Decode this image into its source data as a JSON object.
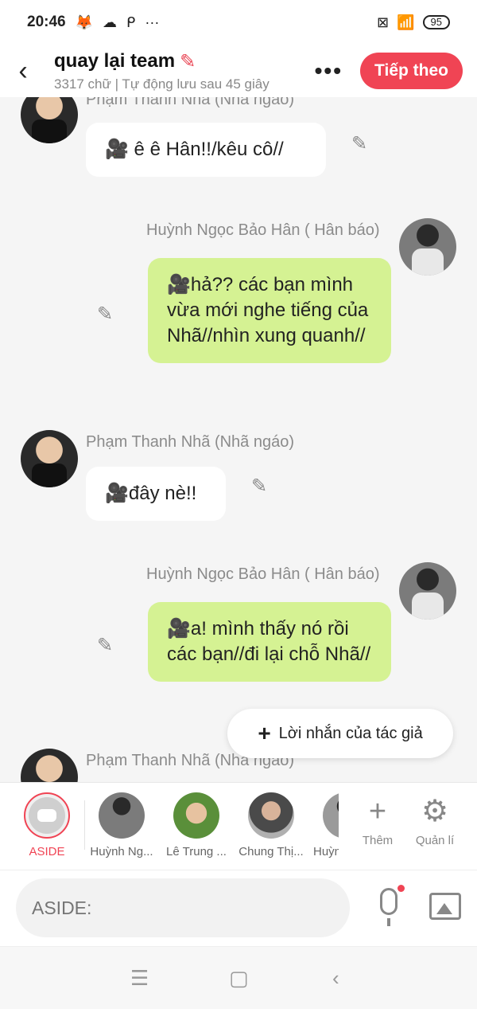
{
  "status_bar": {
    "time": "20:46",
    "left_icons": [
      "fox-icon",
      "cloud-icon",
      "p-icon",
      "ellipsis-icon"
    ],
    "ellipsis": "···",
    "battery": "95"
  },
  "header": {
    "title": "quay lại team",
    "subtitle": "3317 chữ | Tự động lưu sau 45 giây",
    "more": "•••",
    "next_label": "Tiếp theo"
  },
  "messages": [
    {
      "side": "left",
      "sender": "Phạm Thanh Nhã (Nhã ngáo)",
      "text": "🎥 ê ê Hân!!/kêu cô//"
    },
    {
      "side": "right",
      "sender": "Huỳnh Ngọc Bảo Hân ( Hân báo)",
      "text": "🎥hả?? các bạn mình vừa mới nghe tiếng của Nhã//nhìn xung quanh//"
    },
    {
      "side": "left",
      "sender": "Phạm Thanh Nhã (Nhã ngáo)",
      "text": "🎥đây nè!!"
    },
    {
      "side": "right",
      "sender": "Huỳnh Ngọc Bảo Hân ( Hân báo)",
      "text": "🎥a! mình thấy nó rồi các bạn//đi lại chỗ Nhã//"
    },
    {
      "side": "left",
      "sender": "Phạm Thanh Nhã (Nhã ngáo)",
      "text": ""
    }
  ],
  "author_note": {
    "label": "Lời nhắn của tác giả"
  },
  "characters": [
    {
      "label": "ASIDE"
    },
    {
      "label": "Huỳnh Ng..."
    },
    {
      "label": "Lê Trung ..."
    },
    {
      "label": "Chung Thị..."
    },
    {
      "label": "Huỳnh"
    }
  ],
  "tools": [
    {
      "label": "Thêm",
      "icon": "plus-icon"
    },
    {
      "label": "Quản lí",
      "icon": "gear-icon"
    }
  ],
  "input": {
    "placeholder": "ASIDE:"
  },
  "colors": {
    "accent": "#f04454",
    "bubble_right": "#d5f293",
    "bubble_left": "#ffffff"
  }
}
